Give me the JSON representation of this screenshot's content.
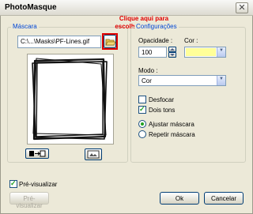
{
  "window": {
    "title": "PhotoMasque",
    "close_glyph": "✕"
  },
  "annotation": {
    "line1": "Clique aqui para",
    "line2": "escolher a moldura"
  },
  "mascara": {
    "legend": "Máscara",
    "file_path": "C:\\...\\Masks\\PF-Lines.gif",
    "open_icon": "folder-open-icon"
  },
  "config": {
    "legend": "Configurações",
    "opacidade_label": "Opacidade :",
    "opacidade_value": "100",
    "cor_label": "Cor :",
    "cor_color": "#ffff99",
    "modo_label": "Modo :",
    "modo_value": "Cor",
    "desfocar_label": "Desfocar",
    "desfocar_checked": false,
    "dois_tons_label": "Dois tons",
    "dois_tons_checked": true,
    "ajustar_label": "Ajustar máscara",
    "repetir_label": "Repetir máscara",
    "selected_mode": "Ajustar máscara"
  },
  "preview": {
    "checkbox_label": "Pré-visualizar",
    "checked": true,
    "button_label": "Pré-visualizar"
  },
  "buttons": {
    "ok": "Ok",
    "cancel": "Cancelar"
  }
}
